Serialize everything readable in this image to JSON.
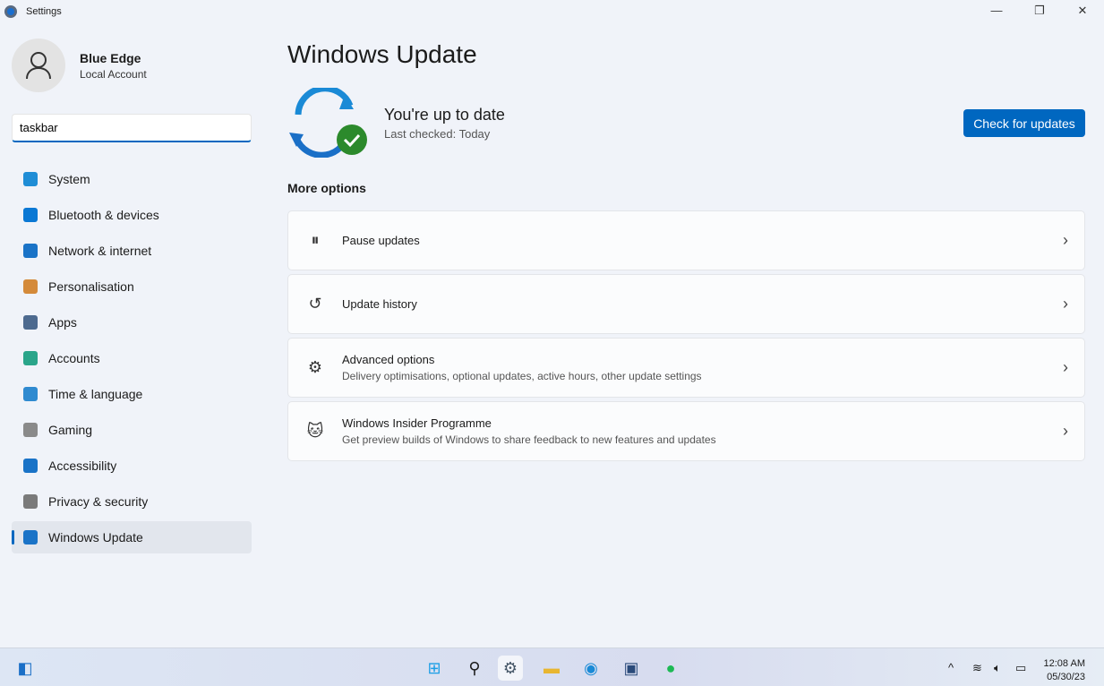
{
  "window": {
    "title": "Settings"
  },
  "profile": {
    "name": "Blue Edge",
    "account": "Local Account"
  },
  "search": {
    "value": "taskbar"
  },
  "nav": [
    {
      "label": "System",
      "color": "#1f8dd6"
    },
    {
      "label": "Bluetooth & devices",
      "color": "#0a78d4"
    },
    {
      "label": "Network & internet",
      "color": "#1a73c7"
    },
    {
      "label": "Personalisation",
      "color": "#d48a3a"
    },
    {
      "label": "Apps",
      "color": "#4d6a8f"
    },
    {
      "label": "Accounts",
      "color": "#2aa58a"
    },
    {
      "label": "Time & language",
      "color": "#2f8ad0"
    },
    {
      "label": "Gaming",
      "color": "#8a8a8a"
    },
    {
      "label": "Accessibility",
      "color": "#1a73c7"
    },
    {
      "label": "Privacy & security",
      "color": "#7a7a7a"
    },
    {
      "label": "Windows Update",
      "color": "#1a73c7"
    }
  ],
  "main": {
    "title": "Windows Update",
    "status": "You're up to date",
    "last_checked": "Last checked: Today",
    "check_button": "Check for updates",
    "more_options": "More options",
    "cards": [
      {
        "title": "Pause updates",
        "subtitle": "",
        "icon": "pause-icon"
      },
      {
        "title": "Update history",
        "subtitle": "",
        "icon": "history-icon"
      },
      {
        "title": "Advanced options",
        "subtitle": "Delivery optimisations, optional updates, active hours, other update settings",
        "icon": "gears-icon"
      },
      {
        "title": "Windows Insider Programme",
        "subtitle": "Get preview builds of Windows to share feedback to new features and updates",
        "icon": "insider-cat-icon"
      }
    ]
  },
  "taskbar": {
    "time": "12:08 AM",
    "date": "05/30/23"
  },
  "colors": {
    "accent": "#0067c0"
  }
}
